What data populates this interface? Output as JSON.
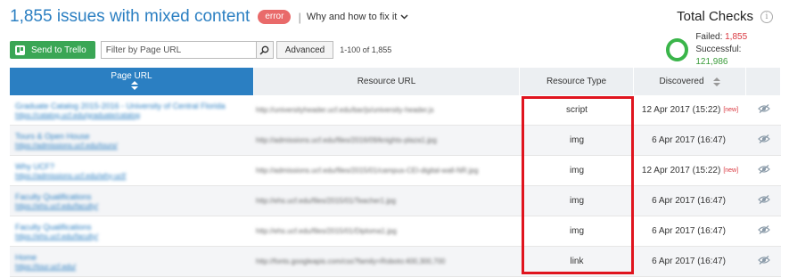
{
  "header": {
    "title": "1,855 issues with mixed content",
    "badge": "error",
    "separator": "|",
    "why_link": "Why and how to fix it"
  },
  "total_checks": {
    "title": "Total Checks",
    "failed_label": "Failed:",
    "failed_value": "1,855",
    "successful_label": "Successful:",
    "successful_value": "121,986"
  },
  "toolbar": {
    "trello_label": "Send to Trello",
    "filter_placeholder": "Filter by Page URL",
    "filter_value": "",
    "advanced_label": "Advanced",
    "range_text": "1-100 of 1,855"
  },
  "table": {
    "columns": [
      "Page URL",
      "Resource URL",
      "Resource Type",
      "Discovered"
    ],
    "rows": [
      {
        "title": "Graduate Catalog 2015-2016 - University of Central Florida",
        "url": "https://catalog.ucf.edu/graduate/catalog",
        "resource": "http://universityheader.ucf.edu/bar/js/university-header.js",
        "type": "script",
        "date": "12 Apr 2017 (15:22)",
        "new": "[new]"
      },
      {
        "title": "Tours & Open House",
        "url": "https://admissions.ucf.edu/tours/",
        "resource": "http://admissions.ucf.edu/files/2016/09/knights-plaza1.jpg",
        "type": "img",
        "date": "6 Apr 2017 (16:47)",
        "new": ""
      },
      {
        "title": "Why UCF?",
        "url": "https://admissions.ucf.edu/why-ucf/",
        "resource": "http://admissions.ucf.edu/files/2015/01/campus-CEI-digital-wall-NR.jpg",
        "type": "img",
        "date": "12 Apr 2017 (15:22)",
        "new": "[new]"
      },
      {
        "title": "Faculty Qualifications",
        "url": "https://ehs.ucf.edu/faculty/",
        "resource": "http://ehs.ucf.edu/files/2015/01/Teacher1.jpg",
        "type": "img",
        "date": "6 Apr 2017 (16:47)",
        "new": ""
      },
      {
        "title": "Faculty Qualifications",
        "url": "https://ehs.ucf.edu/faculty/",
        "resource": "http://ehs.ucf.edu/files/2015/01/Diploma1.jpg",
        "type": "img",
        "date": "6 Apr 2017 (16:47)",
        "new": ""
      },
      {
        "title": "Home",
        "url": "https://tour.ucf.edu/",
        "resource": "http://fonts.googleapis.com/css?family=Roboto:400,300,700",
        "type": "link",
        "date": "6 Apr 2017 (16:47)",
        "new": ""
      }
    ]
  },
  "colors": {
    "accent": "#2b7fc2",
    "error": "#e96a6a",
    "trello": "#3aa655",
    "highlight": "#e0141e"
  }
}
